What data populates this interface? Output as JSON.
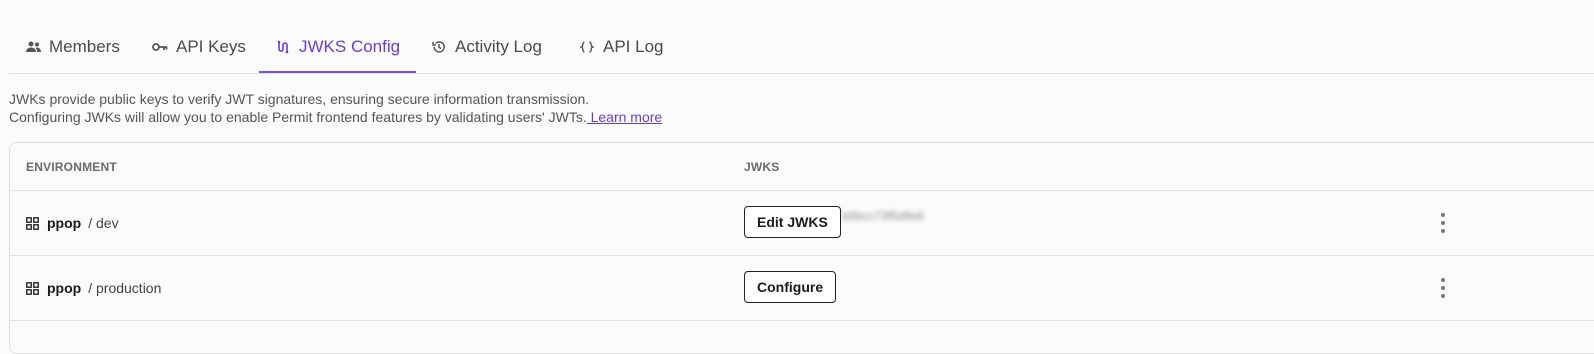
{
  "tabs": [
    {
      "label": "Members",
      "icon": "people-icon"
    },
    {
      "label": "API Keys",
      "icon": "key-icon"
    },
    {
      "label": "JWKS Config",
      "icon": "jwks-icon",
      "active": true
    },
    {
      "label": "Activity Log",
      "icon": "history-icon"
    },
    {
      "label": "API Log",
      "icon": "code-icon"
    }
  ],
  "description": {
    "line1": "JWKs provide public keys to verify JWT signatures, ensuring secure information transmission.",
    "line2": "Configuring JWKs will allow you to enable Permit frontend features by validating users' JWTs.",
    "link": " Learn more"
  },
  "table": {
    "headers": {
      "environment": "ENVIRONMENT",
      "jwks": "JWKS"
    },
    "rows": [
      {
        "project": "ppop",
        "environment": "/ dev",
        "button": "Edit JWKS",
        "jwks_value": "b0bcc73f5d9e6"
      },
      {
        "project": "ppop",
        "environment": "/ production",
        "button": "Configure",
        "jwks_value": ""
      }
    ]
  },
  "colors": {
    "accent": "#6a3fd0",
    "border": "#dedede",
    "background": "#fbfbfb"
  }
}
